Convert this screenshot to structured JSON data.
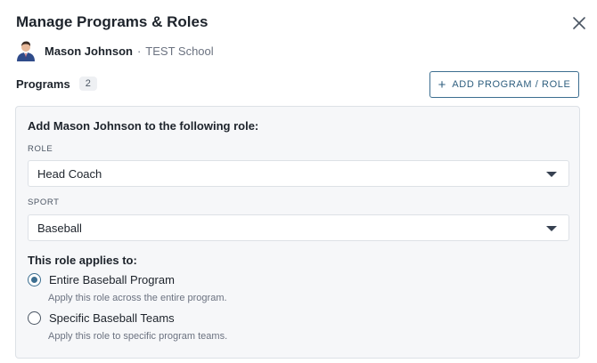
{
  "dialog": {
    "title": "Manage Programs & Roles",
    "close_icon": "close-icon"
  },
  "user": {
    "avatar_icon": "avatar",
    "name": "Mason Johnson",
    "separator": "·",
    "school": "TEST School"
  },
  "programs": {
    "label": "Programs",
    "count": "2",
    "add_button": {
      "icon": "plus-icon",
      "label": "ADD PROGRAM / ROLE"
    }
  },
  "form": {
    "heading": "Add Mason Johnson to the following role:",
    "role": {
      "label": "ROLE",
      "value": "Head Coach"
    },
    "sport": {
      "label": "SPORT",
      "value": "Baseball"
    },
    "applies_label": "This role applies to:",
    "options": [
      {
        "label": "Entire Baseball Program",
        "help": "Apply this role across the entire program.",
        "checked": true
      },
      {
        "label": "Specific Baseball Teams",
        "help": "Apply this role to specific program teams.",
        "checked": false
      }
    ]
  },
  "colors": {
    "accent": "#3c6e90",
    "panel_bg": "#f6f7f9",
    "border": "#dde1e6"
  }
}
